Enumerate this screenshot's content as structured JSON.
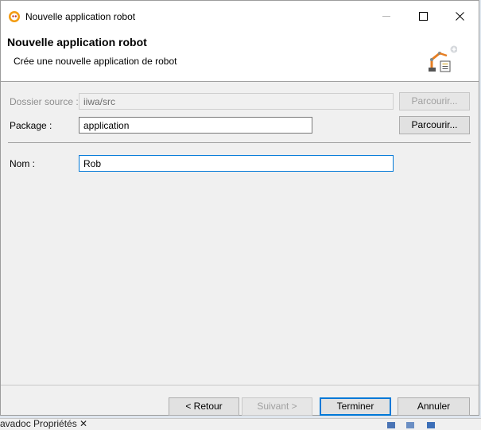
{
  "window": {
    "title": "Nouvelle application robot",
    "minimize_glyph": "",
    "close_glyph": "✕"
  },
  "banner": {
    "title": "Nouvelle application robot",
    "description": "Crée une nouvelle application de robot"
  },
  "form": {
    "source_folder": {
      "label": "Dossier source :",
      "value": "iiwa/src",
      "browse_label": "Parcourir...",
      "enabled": false
    },
    "package": {
      "label": "Package :",
      "value": "application",
      "browse_label": "Parcourir...",
      "enabled": true
    },
    "name": {
      "label": "Nom :",
      "value": "Rob",
      "focused": true
    }
  },
  "buttons": {
    "back": "< Retour",
    "next": "Suivant >",
    "finish": "Terminer",
    "cancel": "Annuler"
  },
  "background": {
    "status_text": "avadoc  Propriétés  ✕"
  },
  "colors": {
    "focus_accent": "#0078d7",
    "dialog_bg": "#f0f0f0"
  }
}
